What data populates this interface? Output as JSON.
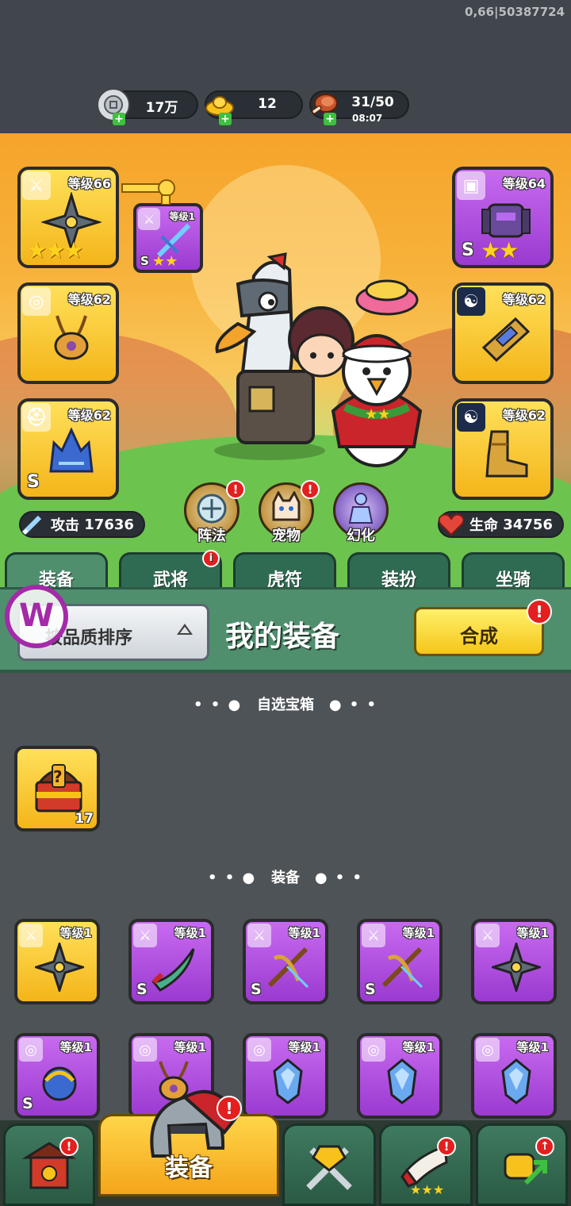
{
  "status": {
    "build_id": "0,66|50387724"
  },
  "resources": {
    "silver": {
      "icon": "silver-coin-icon",
      "value": "17万"
    },
    "gold": {
      "icon": "gold-ingot-icon",
      "value": "12"
    },
    "stamina": {
      "icon": "meat-icon",
      "value": "31/50",
      "timer": "08:07"
    }
  },
  "hero": {
    "left_slots": [
      {
        "level": "等级66",
        "icon": "shuriken-icon",
        "type_icon": "sword-icon",
        "stars": "★★★",
        "rank": ""
      },
      {
        "level": "等级62",
        "icon": "amulet-icon",
        "type_icon": "medal-icon",
        "stars": "",
        "rank": ""
      },
      {
        "level": "等级62",
        "icon": "helmet-icon",
        "type_icon": "helmet-type-icon",
        "stars": "",
        "rank": "S"
      }
    ],
    "right_slots": [
      {
        "level": "等级64",
        "icon": "mech-armor-icon",
        "type_icon": "armor-type-icon",
        "stars": "★★",
        "rank": "S"
      },
      {
        "level": "等级62",
        "icon": "bracer-icon",
        "type_icon": "yin-yang-icon",
        "stars": "",
        "rank": ""
      },
      {
        "level": "等级62",
        "icon": "boots-icon",
        "type_icon": "yin-yang-icon",
        "stars": "",
        "rank": ""
      }
    ],
    "pet_weapon": {
      "level": "等级1",
      "rank": "S",
      "stars": "★★"
    },
    "attack": {
      "label": "攻击",
      "value": "17636"
    },
    "hp": {
      "label": "生命",
      "value": "34756"
    },
    "actions": [
      {
        "label": "阵法",
        "badge": "!"
      },
      {
        "label": "宠物",
        "badge": "!"
      },
      {
        "label": "幻化",
        "badge": ""
      }
    ]
  },
  "tabs": [
    {
      "label": "装备",
      "active": true,
      "badge": ""
    },
    {
      "label": "武将",
      "active": false,
      "badge": "i"
    },
    {
      "label": "虎符",
      "active": false,
      "badge": ""
    },
    {
      "label": "装扮",
      "active": false,
      "badge": ""
    },
    {
      "label": "坐骑",
      "active": false,
      "badge": ""
    }
  ],
  "panel": {
    "sort_label": "按品质排序",
    "title": "我的装备",
    "combine_label": "合成",
    "combine_badge": "!",
    "watermark": "W"
  },
  "sections": {
    "chest": {
      "title": "自选宝箱",
      "dots_left": "• • ●",
      "dots_right": "● • •"
    },
    "equipment": {
      "title": "装备",
      "dots_left": "• • ●",
      "dots_right": "● • •"
    }
  },
  "chest_items": [
    {
      "icon": "mystery-chest-icon",
      "count": "17"
    }
  ],
  "equipment_items": [
    {
      "level": "等级1",
      "rarity": "gold",
      "type_icon": "sword-icon",
      "icon": "shuriken-icon",
      "rank": ""
    },
    {
      "level": "等级1",
      "rarity": "purple",
      "type_icon": "sword-icon",
      "icon": "curved-blade-icon",
      "rank": "S"
    },
    {
      "level": "等级1",
      "rarity": "purple",
      "type_icon": "sword-icon",
      "icon": "crossbow-icon",
      "rank": "S"
    },
    {
      "level": "等级1",
      "rarity": "purple",
      "type_icon": "sword-icon",
      "icon": "crossbow-icon",
      "rank": "S"
    },
    {
      "level": "等级1",
      "rarity": "purple",
      "type_icon": "sword-icon",
      "icon": "shuriken-icon",
      "rank": ""
    },
    {
      "level": "等级1",
      "rarity": "purple",
      "type_icon": "medal-icon",
      "icon": "dragon-amulet-icon",
      "rank": "S"
    },
    {
      "level": "等级1",
      "rarity": "purple",
      "type_icon": "medal-icon",
      "icon": "amulet-icon",
      "rank": ""
    },
    {
      "level": "等级1",
      "rarity": "purple",
      "type_icon": "medal-icon",
      "icon": "blue-pendant-icon",
      "rank": ""
    },
    {
      "level": "等级1",
      "rarity": "purple",
      "type_icon": "medal-icon",
      "icon": "blue-pendant-icon",
      "rank": ""
    },
    {
      "level": "等级1",
      "rarity": "purple",
      "type_icon": "medal-icon",
      "icon": "blue-pendant-icon",
      "rank": ""
    }
  ],
  "bottom_nav": [
    {
      "label": "",
      "icon": "shop-icon",
      "active": false,
      "badge": "!"
    },
    {
      "label": "装备",
      "icon": "knight-helmet-icon",
      "active": true,
      "badge": "!"
    },
    {
      "label": "",
      "icon": "crossed-swords-icon",
      "active": false,
      "badge": ""
    },
    {
      "label": "",
      "icon": "horn-icon",
      "active": false,
      "badge": "!"
    },
    {
      "label": "",
      "icon": "fist-upgrade-icon",
      "active": false,
      "badge": "↑"
    }
  ],
  "colors": {
    "gold_rarity": "#f4b51a",
    "purple_rarity": "#9a3ad0",
    "badge_red": "#e31f1f",
    "panel_green": "#4f8f6e"
  }
}
